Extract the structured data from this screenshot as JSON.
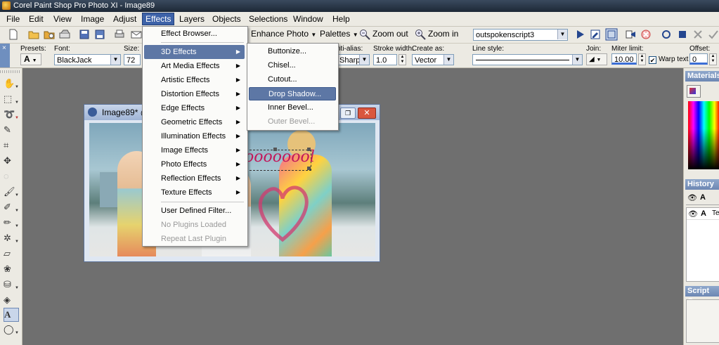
{
  "window": {
    "title": "Corel Paint Shop Pro Photo XI - Image89"
  },
  "menubar": [
    "File",
    "Edit",
    "View",
    "Image",
    "Adjust",
    "Effects",
    "Layers",
    "Objects",
    "Selections",
    "Window",
    "Help"
  ],
  "toolbar1": {
    "enhance_photo": "Enhance Photo",
    "palettes": "Palettes",
    "zoom_out": "Zoom out",
    "zoom_in": "Zoom in",
    "script_combo": "outspokenscript3"
  },
  "options_bar": {
    "presets_label": "Presets:",
    "font_label": "Font:",
    "font_value": "BlackJack",
    "size_label": "Size:",
    "size_value": "72",
    "antialias_label": "nti-alias:",
    "antialias_value": "Sharp",
    "stroke_label": "Stroke width:",
    "stroke_value": "1.0",
    "createas_label": "Create as:",
    "createas_value": "Vector",
    "linestyle_label": "Line style:",
    "join_label": "Join:",
    "miter_label": "Miter limit:",
    "miter_value": "10.00",
    "warp_label": "Warp text",
    "offset_label": "Offset:",
    "offset_value": "0"
  },
  "image_window": {
    "title": "Image89* @",
    "photo_text": "loooooool"
  },
  "effects_menu": {
    "items": [
      {
        "label": "Effect Browser...",
        "sub": false,
        "hl": false,
        "dis": false
      },
      {
        "label": "3D Effects",
        "sub": true,
        "hl": true,
        "dis": false
      },
      {
        "label": "Art Media Effects",
        "sub": true,
        "hl": false,
        "dis": false
      },
      {
        "label": "Artistic Effects",
        "sub": true,
        "hl": false,
        "dis": false
      },
      {
        "label": "Distortion Effects",
        "sub": true,
        "hl": false,
        "dis": false
      },
      {
        "label": "Edge Effects",
        "sub": true,
        "hl": false,
        "dis": false
      },
      {
        "label": "Geometric Effects",
        "sub": true,
        "hl": false,
        "dis": false
      },
      {
        "label": "Illumination Effects",
        "sub": true,
        "hl": false,
        "dis": false
      },
      {
        "label": "Image Effects",
        "sub": true,
        "hl": false,
        "dis": false
      },
      {
        "label": "Photo Effects",
        "sub": true,
        "hl": false,
        "dis": false
      },
      {
        "label": "Reflection Effects",
        "sub": true,
        "hl": false,
        "dis": false
      },
      {
        "label": "Texture Effects",
        "sub": true,
        "hl": false,
        "dis": false
      },
      {
        "label": "User Defined Filter...",
        "sub": false,
        "hl": false,
        "dis": false
      },
      {
        "label": "No Plugins Loaded",
        "sub": false,
        "hl": false,
        "dis": true
      },
      {
        "label": "Repeat Last Plugin",
        "sub": false,
        "hl": false,
        "dis": true
      }
    ]
  },
  "submenu_3d": {
    "items": [
      {
        "label": "Buttonize...",
        "hl": false,
        "dis": false
      },
      {
        "label": "Chisel...",
        "hl": false,
        "dis": false
      },
      {
        "label": "Cutout...",
        "hl": false,
        "dis": false
      },
      {
        "label": "Drop Shadow...",
        "hl": true,
        "dis": false
      },
      {
        "label": "Inner Bevel...",
        "hl": false,
        "dis": false
      },
      {
        "label": "Outer Bevel...",
        "hl": false,
        "dis": true
      }
    ]
  },
  "right_palettes": {
    "materials": "Materials",
    "history": "History",
    "history_item": "Te",
    "script_output": "Script Ou"
  }
}
